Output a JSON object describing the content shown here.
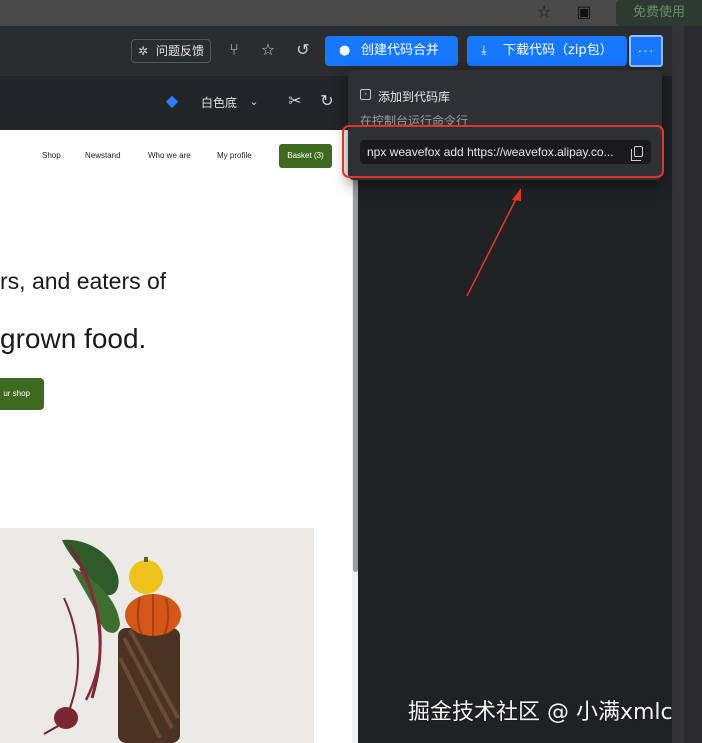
{
  "browser": {
    "free_label": "免费使用"
  },
  "toolbar": {
    "feedback_label": "问题反馈",
    "create_merge_label": "创建代码合并",
    "download_label": "下载代码（zip包）",
    "more_label": "···"
  },
  "subbar": {
    "theme_label": "白色底"
  },
  "preview": {
    "nav": [
      "Shop",
      "Newstand",
      "Who we are",
      "My profile"
    ],
    "basket_label": "Basket (3)",
    "hero_line1": "rs, and eaters of",
    "hero_line2": "grown food.",
    "shop_button": "ur shop"
  },
  "dropdown": {
    "add_repo_label": "添加到代码库",
    "console_label": "在控制台运行命令行",
    "command": "npx weavefox add https://weavefox.alipay.co..."
  },
  "watermark": "掘金技术社区 @ 小满xmlc",
  "colors": {
    "accent_blue": "#1677ff",
    "brand_green": "#3e6a1f",
    "highlight_red": "#e0352d"
  }
}
